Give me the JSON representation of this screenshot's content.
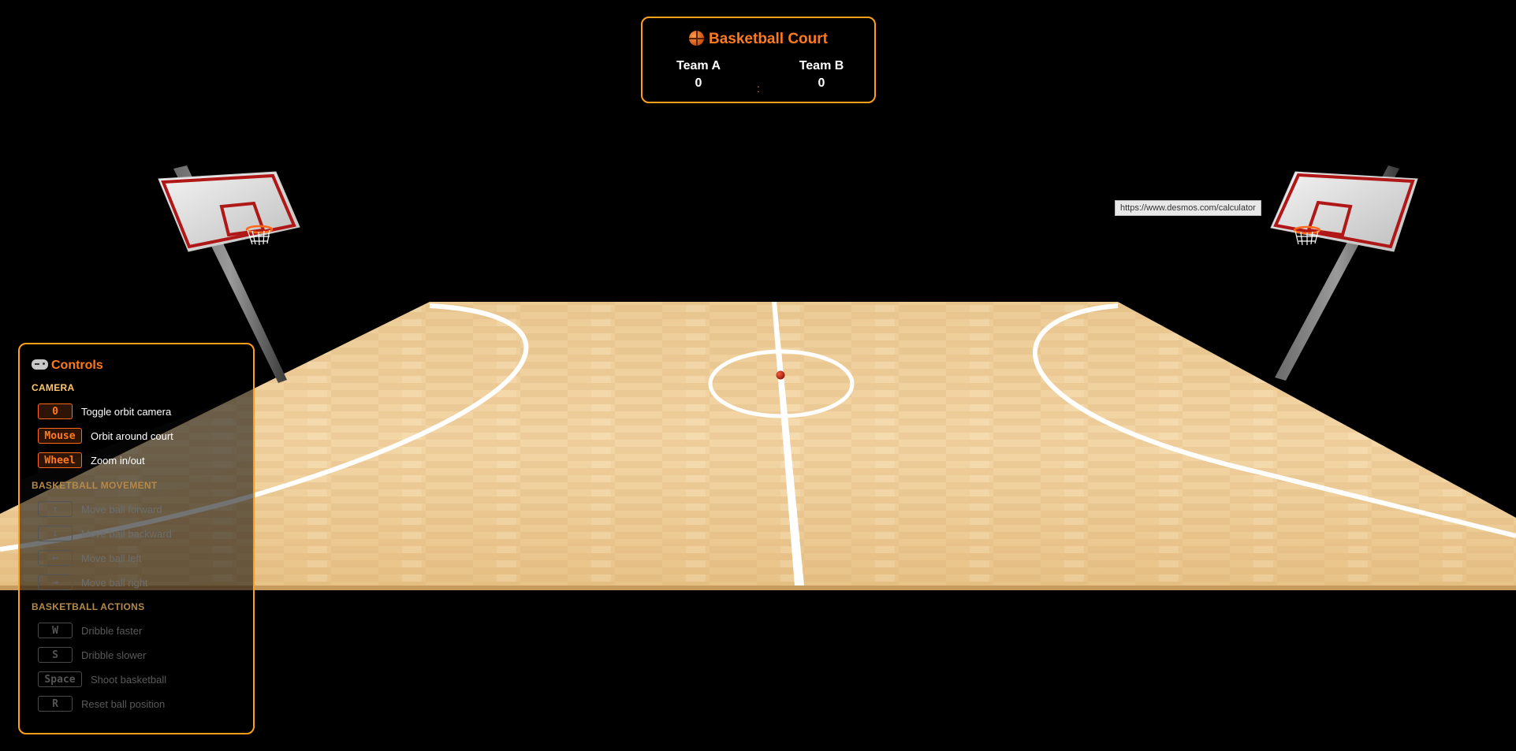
{
  "scoreboard": {
    "title": "Basketball Court",
    "team_a_name": "Team A",
    "team_a_score": "0",
    "separator": ":",
    "team_b_name": "Team B",
    "team_b_score": "0"
  },
  "tooltip": {
    "text": "https://www.desmos.com/calculator"
  },
  "controls": {
    "title": "Controls",
    "sections": [
      {
        "title": "CAMERA",
        "items": [
          {
            "key": "0",
            "label": "Toggle orbit camera"
          },
          {
            "key": "Mouse",
            "label": "Orbit around court"
          },
          {
            "key": "Wheel",
            "label": "Zoom in/out"
          }
        ]
      },
      {
        "title": "BASKETBALL MOVEMENT",
        "items": [
          {
            "key": "↑",
            "label": "Move ball forward"
          },
          {
            "key": "↓",
            "label": "Move ball backward"
          },
          {
            "key": "←",
            "label": "Move ball left"
          },
          {
            "key": "→",
            "label": "Move ball right"
          }
        ]
      },
      {
        "title": "BASKETBALL ACTIONS",
        "items": [
          {
            "key": "W",
            "label": "Dribble faster"
          },
          {
            "key": "S",
            "label": "Dribble slower"
          },
          {
            "key": "Space",
            "label": "Shoot basketball"
          },
          {
            "key": "R",
            "label": "Reset ball position"
          }
        ]
      }
    ]
  },
  "colors": {
    "accent": "#ff7a1a",
    "border": "#ff9f1a",
    "section_title": "#ffc76a",
    "floor_light": "#f1d3a2",
    "floor_dark": "#d9ae72",
    "background": "#000000"
  },
  "icons": {
    "title_icon": "basketball-icon",
    "controls_icon": "gamepad-icon"
  }
}
